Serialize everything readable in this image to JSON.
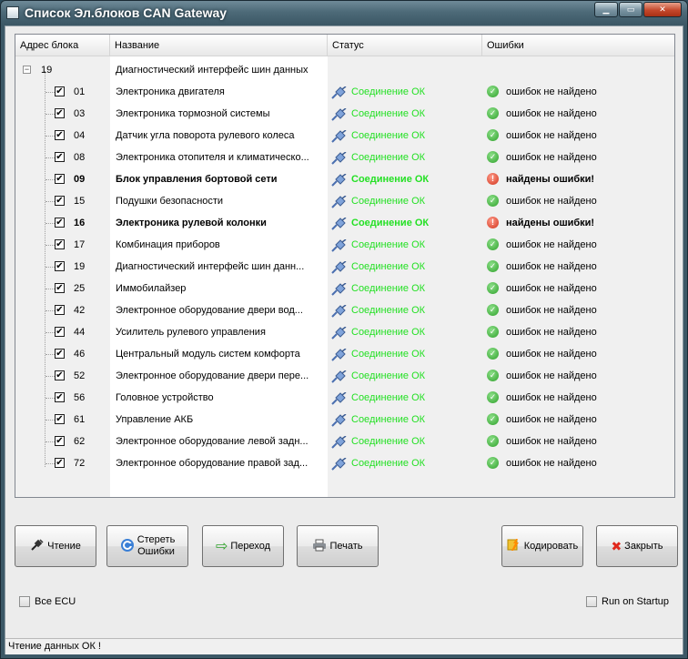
{
  "window": {
    "title": "Список Эл.блоков CAN Gateway",
    "minimize": "▁",
    "maximize": "▭",
    "close": "✕"
  },
  "table": {
    "headers": [
      "Адрес блока",
      "Название",
      "Статус",
      "Ошибки"
    ],
    "root": {
      "expander": "−",
      "address": "19",
      "name": "Диагностический интерфейс шин данных"
    },
    "rows": [
      {
        "address": "01",
        "name": "Электроника двигателя",
        "status": "Соединение ОК",
        "errors": "ошибок не найдено",
        "ok": true
      },
      {
        "address": "03",
        "name": "Электроника тормозной системы",
        "status": "Соединение ОК",
        "errors": "ошибок не найдено",
        "ok": true
      },
      {
        "address": "04",
        "name": "Датчик угла поворота рулевого колеса",
        "status": "Соединение ОК",
        "errors": "ошибок не найдено",
        "ok": true
      },
      {
        "address": "08",
        "name": "Электроника отопителя и климатическо...",
        "status": "Соединение ОК",
        "errors": "ошибок не найдено",
        "ok": true
      },
      {
        "address": "09",
        "name": "Блок управления бортовой сети",
        "status": "Соединение ОК",
        "errors": "найдены ошибки!",
        "ok": false
      },
      {
        "address": "15",
        "name": "Подушки безопасности",
        "status": "Соединение ОК",
        "errors": "ошибок не найдено",
        "ok": true
      },
      {
        "address": "16",
        "name": "Электроника рулевой колонки",
        "status": "Соединение ОК",
        "errors": "найдены ошибки!",
        "ok": false
      },
      {
        "address": "17",
        "name": "Комбинация приборов",
        "status": "Соединение ОК",
        "errors": "ошибок не найдено",
        "ok": true
      },
      {
        "address": "19",
        "name": "Диагностический интерфейс шин данн...",
        "status": "Соединение ОК",
        "errors": "ошибок не найдено",
        "ok": true
      },
      {
        "address": "25",
        "name": "Иммобилайзер",
        "status": "Соединение ОК",
        "errors": "ошибок не найдено",
        "ok": true
      },
      {
        "address": "42",
        "name": "Электронное оборудование двери вод...",
        "status": "Соединение ОК",
        "errors": "ошибок не найдено",
        "ok": true
      },
      {
        "address": "44",
        "name": "Усилитель рулевого управления",
        "status": "Соединение ОК",
        "errors": "ошибок не найдено",
        "ok": true
      },
      {
        "address": "46",
        "name": "Центральный модуль систем комфорта",
        "status": "Соединение ОК",
        "errors": "ошибок не найдено",
        "ok": true
      },
      {
        "address": "52",
        "name": "Электронное оборудование двери пере...",
        "status": "Соединение ОК",
        "errors": "ошибок не найдено",
        "ok": true
      },
      {
        "address": "56",
        "name": "Головное устройство",
        "status": "Соединение ОК",
        "errors": "ошибок не найдено",
        "ok": true
      },
      {
        "address": "61",
        "name": "Управление АКБ",
        "status": "Соединение ОК",
        "errors": "ошибок не найдено",
        "ok": true
      },
      {
        "address": "62",
        "name": "Электронное оборудование левой задн...",
        "status": "Соединение ОК",
        "errors": "ошибок не найдено",
        "ok": true
      },
      {
        "address": "72",
        "name": "Электронное оборудование правой зад...",
        "status": "Соединение ОК",
        "errors": "ошибок не найдено",
        "ok": true
      }
    ],
    "checkmark": "✔",
    "ok_icon": "check-circle-icon",
    "error_icon": "exclamation-circle-icon",
    "status_icon": "connector-plug-icon"
  },
  "buttons": {
    "read": "Чтение",
    "clear_errors": "Стереть\nОшибки",
    "goto": "Переход",
    "print": "Печать",
    "code": "Кодировать",
    "close": "Закрыть"
  },
  "options": {
    "all_ecu": "Все ECU",
    "run_on_startup": "Run on Startup"
  },
  "statusbar": {
    "text": "Чтение данных ОК !"
  },
  "colors": {
    "ok_text": "#24e024",
    "ok_icon": "#2ea12a",
    "error_icon": "#d1321a"
  }
}
